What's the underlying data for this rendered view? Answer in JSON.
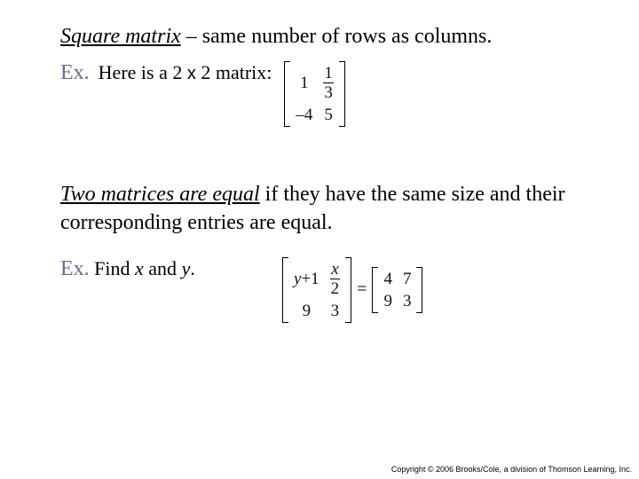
{
  "def": {
    "term": "Square matrix",
    "dash": " – ",
    "rest": "same number of rows as columns."
  },
  "ex1": {
    "label": "Ex.",
    "text_a": "Here is a 2 ",
    "text_x": "x",
    "text_b": " 2 matrix:",
    "m": {
      "r1c1": "1",
      "r1c2_num": "1",
      "r1c2_den": "3",
      "r2c1": "–4",
      "r2c2": "5"
    }
  },
  "equal_def": {
    "lead": "Two matrices are equal",
    "rest": " if they have the same size and their corresponding entries are equal."
  },
  "ex2": {
    "label": "Ex.",
    "text_a": "Find ",
    "var_x": "x",
    "text_b": " and ",
    "var_y": "y",
    "text_c": ".",
    "left": {
      "r1c1_a": "y",
      "r1c1_b": "+1",
      "r1c2_num": "x",
      "r1c2_den": "2",
      "r2c1": "9",
      "r2c2": "3"
    },
    "eq": "=",
    "right": {
      "r1c1": "4",
      "r1c2": "7",
      "r2c1": "9",
      "r2c2": "3"
    }
  },
  "copyright": "Copyright © 2006 Brooks/Cole, a division of Thomson Learning, Inc."
}
